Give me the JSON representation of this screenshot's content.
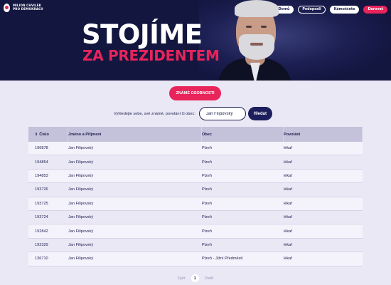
{
  "logo": {
    "line1": "MILION CHVILEK",
    "line2": "PRO DEMOKRACII"
  },
  "nav": {
    "items": [
      "Domů",
      "Podepsali",
      "Kámoščete",
      "Darovat"
    ]
  },
  "hero": {
    "line1": "STOJÍME",
    "line2": "ZA PREZIDENTEM"
  },
  "famous_button": "ZNÁMÉ OSOBNOSTI",
  "search": {
    "label": "Vyhledejte sebe, své známé, povolání či obec:",
    "value": "Jan Filipovský",
    "button": "Hledat"
  },
  "table": {
    "headers": [
      "Číslo",
      "Jméno a Příjmení",
      "Obec",
      "Povolání"
    ],
    "rows": [
      [
        "196878",
        "Jan Filipovský",
        "Plzeň",
        "lékař"
      ],
      [
        "194854",
        "Jan Filipovský",
        "Plzeň",
        "lékař"
      ],
      [
        "194853",
        "Jan Filipovský",
        "Plzeň",
        "lékař"
      ],
      [
        "193726",
        "Jan Filipovský",
        "Plzeň",
        "lékař"
      ],
      [
        "193725",
        "Jan Filipovský",
        "Plzeň",
        "lékař"
      ],
      [
        "193724",
        "Jan Filipovský",
        "Plzeň",
        "lékař"
      ],
      [
        "192842",
        "Jan Filipovský",
        "Plzeň",
        "lékař"
      ],
      [
        "192329",
        "Jan Filipovský",
        "Plzeň",
        "lékař"
      ],
      [
        "136710",
        "Jan Filipovský",
        "Plzeň - Jižní Předměstí",
        "lékař"
      ]
    ]
  },
  "pagination": {
    "prev": "Zpět",
    "current": "1",
    "next": "Další"
  },
  "colors": {
    "navy": "#13163f",
    "accent": "#e8245b",
    "background": "#ebe8f6",
    "header_row": "#c4c1da"
  },
  "icons": {
    "sort": "sort-icon",
    "logo": "logo-icon"
  }
}
